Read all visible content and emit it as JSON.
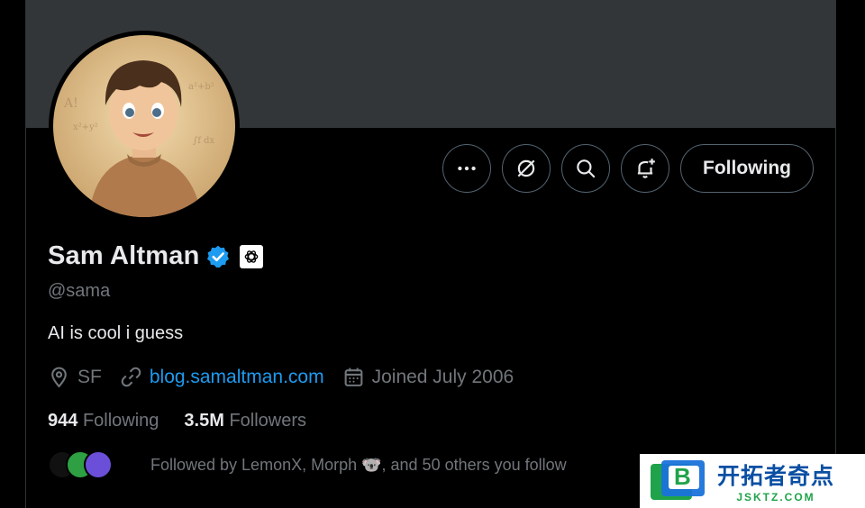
{
  "profile": {
    "name": "Sam Altman",
    "handle": "@sama",
    "bio": "AI is cool i guess",
    "location": "SF",
    "website": "blog.samaltman.com",
    "joined": "Joined July 2006",
    "following_count": "944",
    "following_label": "Following",
    "followers_count": "3.5M",
    "followers_label": "Followers",
    "followed_by": "Followed by LemonX, Morph 🐨, and 50 others you follow"
  },
  "actions": {
    "more_icon": "more-icon",
    "grok_icon": "grok-icon",
    "search_icon": "search-icon",
    "notify_icon": "notification-bell-icon",
    "follow_label": "Following"
  },
  "colors": {
    "background": "#000000",
    "banner": "#333639",
    "accent_link": "#1d9bf0",
    "verified": "#1d9bf0",
    "muted_text": "#71767b",
    "primary_text": "#e7e9ea"
  },
  "watermark": {
    "title": "开拓者奇点",
    "subtitle": "JSKTZ.COM",
    "logo_letter": "B"
  }
}
